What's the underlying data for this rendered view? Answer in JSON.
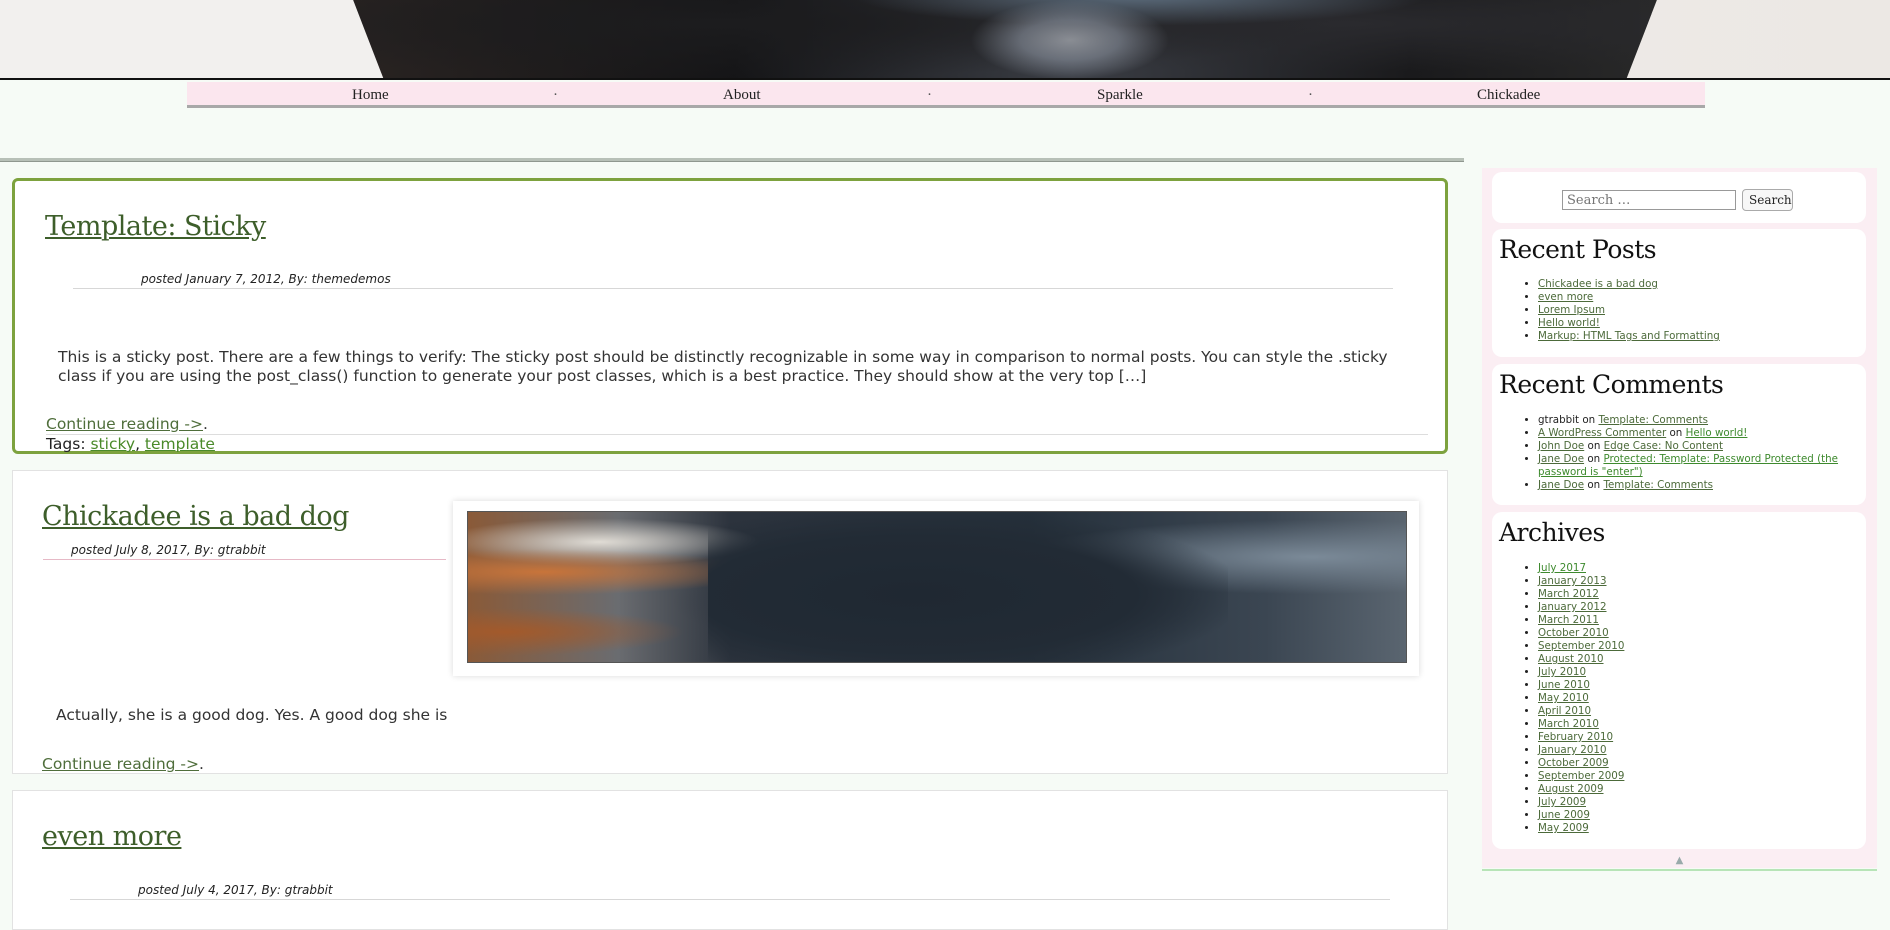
{
  "nav": {
    "items": [
      {
        "label": "Home"
      },
      {
        "label": "About"
      },
      {
        "label": "Sparkle"
      },
      {
        "label": "Chickadee"
      }
    ],
    "separator": "·"
  },
  "posts": [
    {
      "title": "Template: Sticky",
      "meta": "posted January 7, 2012, By: themedemos",
      "excerpt": "This is a sticky post. There are a few things to verify: The sticky post should be distinctly recognizable in some way in comparison to normal posts. You can style the .sticky class if you are using the post_class() function to generate your post classes, which is a best practice. They should show at the very top […]",
      "continue_label": "Continue reading ->",
      "continue_suffix": ".",
      "tags_label": "Tags:",
      "tags": [
        "sticky",
        "template"
      ]
    },
    {
      "title": "Chickadee is a bad dog",
      "meta": "posted July 8, 2017, By: gtrabbit",
      "excerpt": "Actually, she is a good dog.   Yes. A good dog she is",
      "continue_label": "Continue reading ->",
      "continue_suffix": "."
    },
    {
      "title": "even more",
      "meta": "posted July 4, 2017, By: gtrabbit"
    }
  ],
  "sidebar": {
    "search": {
      "placeholder": "Search …",
      "button": "Search"
    },
    "recent_posts": {
      "title": "Recent Posts",
      "items": [
        "Chickadee is a bad dog",
        "even more",
        "Lorem Ipsum",
        "Hello world!",
        "Markup: HTML Tags and Formatting"
      ]
    },
    "recent_comments": {
      "title": "Recent Comments",
      "items": [
        {
          "author": "gtrabbit",
          "author_link": false,
          "on": "on",
          "post": "Template: Comments"
        },
        {
          "author": "A WordPress Commenter",
          "author_link": true,
          "on": "on",
          "post": "Hello world!"
        },
        {
          "author": "John Doe",
          "author_link": true,
          "on": "on",
          "post": "Edge Case: No Content"
        },
        {
          "author": "Jane Doe",
          "author_link": true,
          "on": "on",
          "post": "Protected: Template: Password Protected (the password is \"enter\")"
        },
        {
          "author": "Jane Doe",
          "author_link": true,
          "on": "on",
          "post": "Template: Comments"
        }
      ]
    },
    "archives": {
      "title": "Archives",
      "items": [
        "July 2017",
        "January 2013",
        "March 2012",
        "January 2012",
        "March 2011",
        "October 2010",
        "September 2010",
        "August 2010",
        "July 2010",
        "June 2010",
        "May 2010",
        "April 2010",
        "March 2010",
        "February 2010",
        "January 2010",
        "October 2009",
        "September 2009",
        "August 2009",
        "July 2009",
        "June 2009",
        "May 2009"
      ]
    },
    "scroll_top_glyph": "▲"
  }
}
